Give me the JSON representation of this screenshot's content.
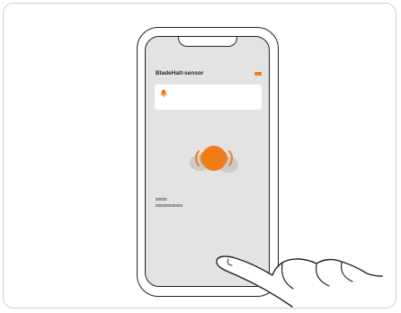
{
  "app": {
    "title": "BladeHalt-sensor",
    "accent_color": "#f07d1a"
  },
  "notification_card": {
    "icon": "bell-icon"
  },
  "sensor": {
    "icon": "sensor-vibrating-icon"
  },
  "info": {
    "line1": "xxxxx",
    "line2": "xxxxxxxxxxxx"
  },
  "gesture": {
    "icon": "pointing-hand-icon"
  }
}
